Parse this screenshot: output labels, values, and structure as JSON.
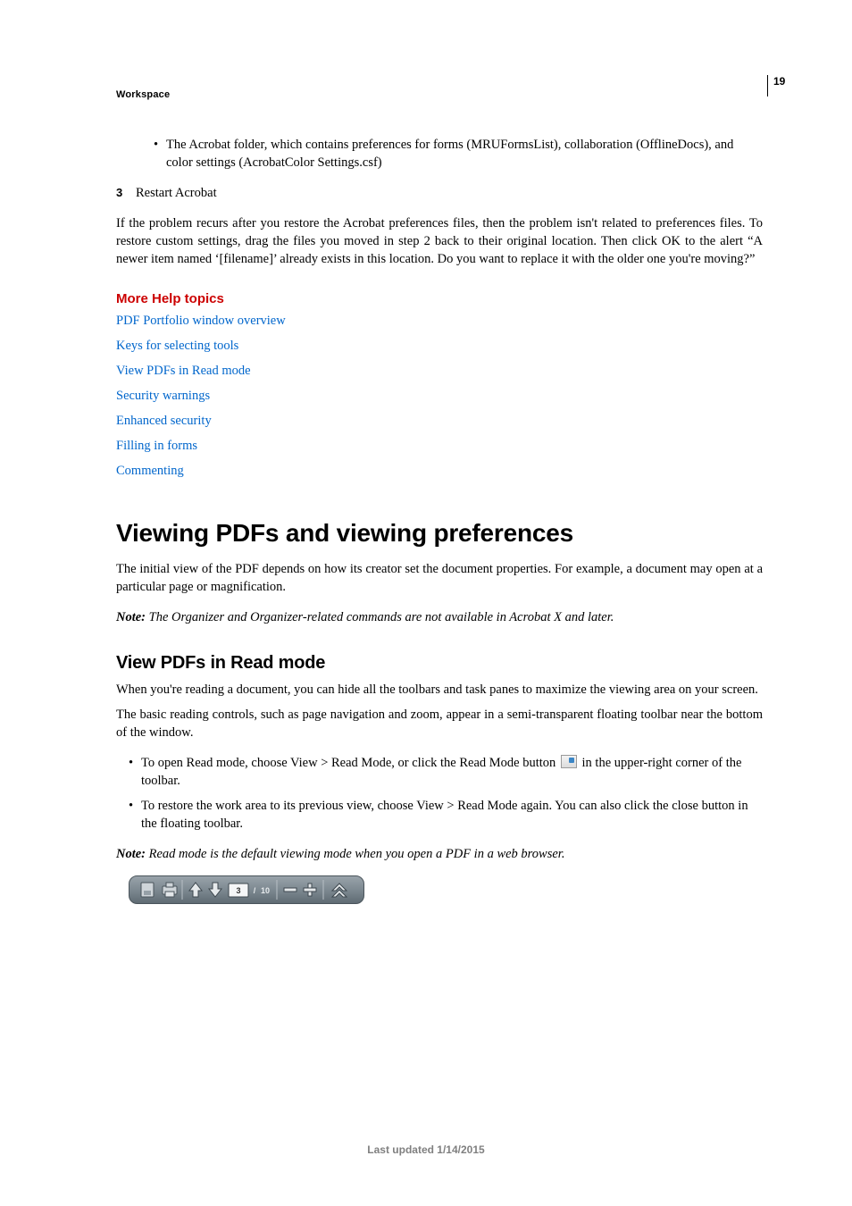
{
  "page_number": "19",
  "section_label": "Workspace",
  "bullet_intro": "The Acrobat folder, which contains preferences for forms (MRUFormsList), collaboration (OfflineDocs), and color settings (AcrobatColor Settings.csf)",
  "step3_num": "3",
  "step3_text": "Restart Acrobat",
  "para_after_steps": "If the problem recurs after you restore the Acrobat preferences files, then the problem isn't related to preferences files. To restore custom settings, drag the files you moved in step 2 back to their original location. Then click OK to the alert “A newer item named ‘[filename]’ already exists in this location. Do you want to replace it with the older one you're moving?”",
  "more_help_heading": "More Help topics",
  "links": [
    "PDF Portfolio window overview",
    "Keys for selecting tools",
    "View PDFs in Read mode",
    "Security warnings",
    "Enhanced security",
    "Filling in forms",
    "Commenting"
  ],
  "h1": "Viewing PDFs and viewing preferences",
  "intro_para": "The initial view of the PDF depends on how its creator set the document properties. For example, a document may open at a particular page or magnification.",
  "note1_label": "Note:",
  "note1_body": "  The Organizer and Organizer-related commands are not available in Acrobat X and later.",
  "h2": "View PDFs in Read mode",
  "h2_para1": "When you're reading a document, you can hide all the toolbars and task panes to maximize the viewing area on your screen.",
  "h2_para2": "The basic reading controls, such as page navigation and zoom, appear in a semi-transparent floating toolbar near the bottom of the window.",
  "h2_bullet1_a": "To open Read mode, choose View > Read Mode, or click the Read Mode button ",
  "h2_bullet1_b": " in the upper-right corner of the toolbar.",
  "h2_bullet2": "To restore the work area to its previous view, choose View > Read Mode again. You can also click the close button in the floating toolbar.",
  "note2_label": "Note:",
  "note2_body": " Read mode is the default viewing mode when you open a PDF in a web browser.",
  "toolbar": {
    "page_current": "3",
    "page_sep": "/",
    "page_total": "10"
  },
  "footer": "Last updated 1/14/2015"
}
